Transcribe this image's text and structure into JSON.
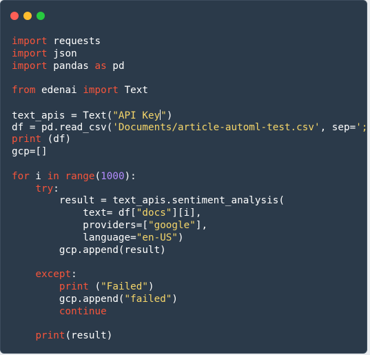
{
  "window": {
    "controls": [
      {
        "name": "close",
        "color": "#ff5f56"
      },
      {
        "name": "minimize",
        "color": "#ffbd2e"
      },
      {
        "name": "maximize",
        "color": "#27c93f"
      }
    ]
  },
  "colors": {
    "background": "#2b3a4a",
    "keyword": "#f7553b",
    "string": "#f5d66a",
    "number": "#b58cff",
    "text": "#ffffff"
  },
  "code": {
    "cursor_line": 6,
    "lines": [
      [
        {
          "t": "import",
          "c": "kw"
        },
        {
          "t": " requests",
          "c": ""
        }
      ],
      [
        {
          "t": "import",
          "c": "kw"
        },
        {
          "t": " json",
          "c": ""
        }
      ],
      [
        {
          "t": "import",
          "c": "kw"
        },
        {
          "t": " pandas ",
          "c": ""
        },
        {
          "t": "as",
          "c": "kw"
        },
        {
          "t": " pd",
          "c": ""
        }
      ],
      [],
      [
        {
          "t": "from",
          "c": "kw"
        },
        {
          "t": " edenai ",
          "c": ""
        },
        {
          "t": "import",
          "c": "kw"
        },
        {
          "t": " Text",
          "c": ""
        }
      ],
      [],
      [
        {
          "t": "text_apis = Text(",
          "c": ""
        },
        {
          "t": "\"API Key",
          "c": "str"
        },
        {
          "t": "|cursor|",
          "c": "cursor"
        },
        {
          "t": "\"",
          "c": "str"
        },
        {
          "t": ")",
          "c": ""
        }
      ],
      [
        {
          "t": "df = pd.read_csv(",
          "c": ""
        },
        {
          "t": "'Documents/article-automl-test.csv'",
          "c": "str"
        },
        {
          "t": ", sep=",
          "c": ""
        },
        {
          "t": "';'",
          "c": "str"
        },
        {
          "t": ")",
          "c": ""
        }
      ],
      [
        {
          "t": "print",
          "c": "kw"
        },
        {
          "t": " (df)",
          "c": ""
        }
      ],
      [
        {
          "t": "gcp=[]",
          "c": ""
        }
      ],
      [],
      [
        {
          "t": "for",
          "c": "kw"
        },
        {
          "t": " i ",
          "c": ""
        },
        {
          "t": "in",
          "c": "kw"
        },
        {
          "t": " ",
          "c": ""
        },
        {
          "t": "range",
          "c": "kw"
        },
        {
          "t": "(",
          "c": ""
        },
        {
          "t": "1000",
          "c": "num"
        },
        {
          "t": "):",
          "c": ""
        }
      ],
      [
        {
          "t": "    ",
          "c": ""
        },
        {
          "t": "try",
          "c": "kw"
        },
        {
          "t": ":",
          "c": ""
        }
      ],
      [
        {
          "t": "        result = text_apis.sentiment_analysis(",
          "c": ""
        }
      ],
      [
        {
          "t": "            text= df[",
          "c": ""
        },
        {
          "t": "\"docs\"",
          "c": "str"
        },
        {
          "t": "][i],",
          "c": ""
        }
      ],
      [
        {
          "t": "            providers=[",
          "c": ""
        },
        {
          "t": "\"google\"",
          "c": "str"
        },
        {
          "t": "],",
          "c": ""
        }
      ],
      [
        {
          "t": "            language=",
          "c": ""
        },
        {
          "t": "\"en-US\"",
          "c": "str"
        },
        {
          "t": ")",
          "c": ""
        }
      ],
      [
        {
          "t": "        gcp.append(result)",
          "c": ""
        }
      ],
      [],
      [
        {
          "t": "    ",
          "c": ""
        },
        {
          "t": "except",
          "c": "kw"
        },
        {
          "t": ":",
          "c": ""
        }
      ],
      [
        {
          "t": "        ",
          "c": ""
        },
        {
          "t": "print",
          "c": "kw"
        },
        {
          "t": " (",
          "c": ""
        },
        {
          "t": "\"Failed\"",
          "c": "str"
        },
        {
          "t": ")",
          "c": ""
        }
      ],
      [
        {
          "t": "        gcp.append(",
          "c": ""
        },
        {
          "t": "\"failed\"",
          "c": "str"
        },
        {
          "t": ")",
          "c": ""
        }
      ],
      [
        {
          "t": "        ",
          "c": ""
        },
        {
          "t": "continue",
          "c": "kw"
        }
      ],
      [],
      [
        {
          "t": "    ",
          "c": ""
        },
        {
          "t": "print",
          "c": "kw"
        },
        {
          "t": "(result)",
          "c": ""
        }
      ]
    ]
  }
}
